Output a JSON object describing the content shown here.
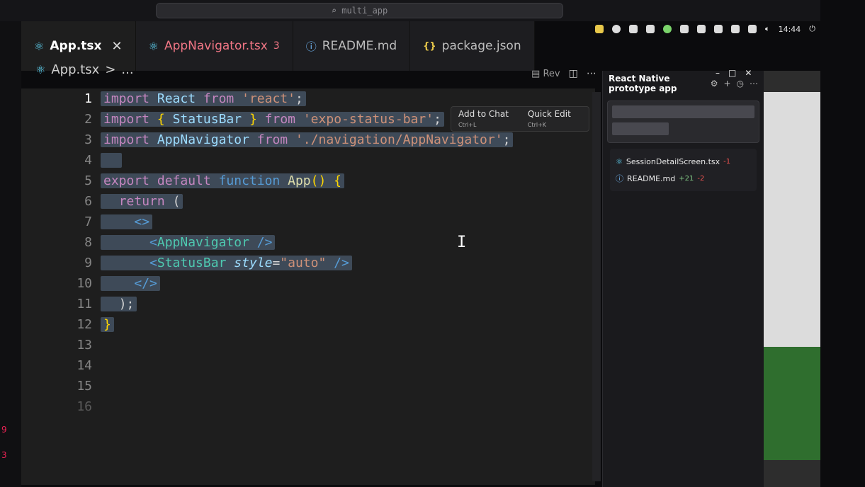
{
  "command_center": {
    "text": "multi_app"
  },
  "tray": {
    "time": "14:44"
  },
  "tabs": [
    {
      "label": "App.tsx",
      "active": true,
      "close": "✕"
    },
    {
      "label": "AppNavigator.tsx",
      "badge": "3"
    },
    {
      "label": "README.md"
    },
    {
      "label": "package.json"
    }
  ],
  "tab_actions": {
    "rev_label": "Rev"
  },
  "breadcrumb": {
    "file": "App.tsx",
    "sep": ">",
    "more": "..."
  },
  "editor": {
    "line_numbers": [
      "1",
      "2",
      "3",
      "4",
      "5",
      "6",
      "7",
      "8",
      "9",
      "10",
      "11",
      "12",
      "13",
      "14",
      "15",
      "16"
    ],
    "code": {
      "l1": [
        "import",
        "React",
        "from",
        "'react'",
        ";"
      ],
      "l2": [
        "import",
        "{",
        "StatusBar",
        "}",
        "from",
        "'expo-status-bar'",
        ";"
      ],
      "l3": [
        "import",
        "AppNavigator",
        "from",
        "'./navigation/AppNavigator'",
        ";"
      ],
      "l5": [
        "export",
        "default",
        "function",
        "App",
        "()",
        "{"
      ],
      "l6": [
        "return",
        "("
      ],
      "l7": "<>",
      "l8": [
        "<",
        "AppNavigator",
        "/>"
      ],
      "l9": [
        "<",
        "StatusBar",
        "style",
        "=",
        "\"auto\"",
        "/>"
      ],
      "l10": "</>",
      "l11": ");",
      "l12": "}"
    }
  },
  "hint": {
    "add_to_chat": "Add to Chat",
    "add_kbd": "Ctrl+L",
    "quick_edit": "Quick Edit",
    "quick_kbd": "Ctrl+K"
  },
  "panel": {
    "title": "React Native prototype app",
    "files": [
      {
        "name": "SessionDetailScreen.tsx",
        "del": "-1"
      },
      {
        "name": "README.md",
        "add": "+21",
        "del": "-2"
      }
    ]
  },
  "colors": {
    "accent_react": "#61dafb",
    "error": "#f27685"
  }
}
